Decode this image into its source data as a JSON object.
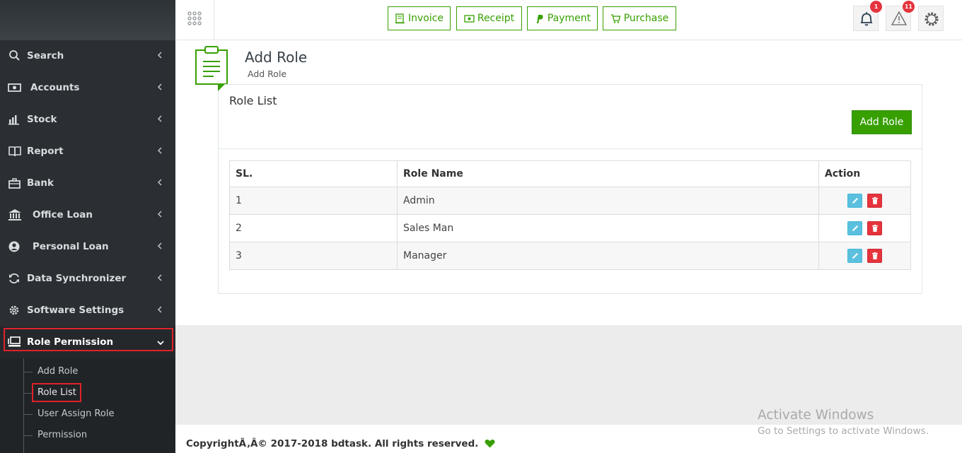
{
  "sidebar": {
    "items": [
      {
        "label": "Search",
        "icon": "search-icon"
      },
      {
        "label": "Accounts",
        "icon": "money-icon"
      },
      {
        "label": "Stock",
        "icon": "bar-chart-icon"
      },
      {
        "label": "Report",
        "icon": "book-icon"
      },
      {
        "label": "Bank",
        "icon": "briefcase-icon"
      },
      {
        "label": "Office Loan",
        "icon": "bank-icon"
      },
      {
        "label": "Personal Loan",
        "icon": "user-circle-icon"
      },
      {
        "label": "Data Synchronizer",
        "icon": "sync-icon"
      },
      {
        "label": "Software Settings",
        "icon": "gear-icon"
      },
      {
        "label": "Role Permission",
        "icon": "desktop-icon"
      }
    ],
    "submenu": [
      "Add Role",
      "Role List",
      "User Assign Role",
      "Permission"
    ]
  },
  "header": {
    "quick_buttons": [
      {
        "label": "Invoice",
        "icon": "invoice-icon"
      },
      {
        "label": "Receipt",
        "icon": "money-icon"
      },
      {
        "label": "Payment",
        "icon": "paypal-icon"
      },
      {
        "label": "Purchase",
        "icon": "cart-icon"
      }
    ],
    "notifications_count": "1",
    "alerts_count": "11"
  },
  "page": {
    "title": "Add Role",
    "subtitle": "Add Role"
  },
  "panel": {
    "title": "Role List",
    "add_button": "Add Role",
    "columns": [
      "SL.",
      "Role Name",
      "Action"
    ],
    "rows": [
      {
        "sl": "1",
        "name": "Admin"
      },
      {
        "sl": "2",
        "name": "Sales Man"
      },
      {
        "sl": "3",
        "name": "Manager"
      }
    ]
  },
  "footer": {
    "copyright": "CopyrightÃ‚Â© 2017-2018 bdtask. All rights reserved."
  },
  "watermark": {
    "line1": "Activate Windows",
    "line2": "Go to Settings to activate Windows."
  },
  "colors": {
    "accent": "#37a000",
    "sidebar_bg": "#2b2f33",
    "danger": "#e5343d",
    "info": "#5bc0de",
    "highlight_box": "#e0222b"
  }
}
